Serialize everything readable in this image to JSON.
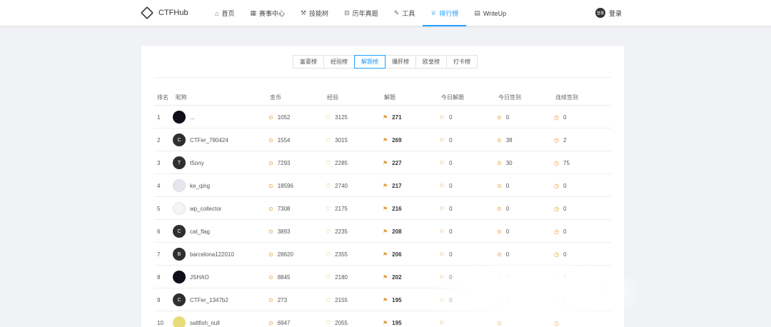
{
  "header": {
    "brand": "CTFHub",
    "nav": [
      {
        "icon": "home-icon",
        "glyph": "⌂",
        "label": "首页"
      },
      {
        "icon": "calendar-icon",
        "glyph": "▦",
        "label": "赛事中心"
      },
      {
        "icon": "skill-icon",
        "glyph": "⚒",
        "label": "技能树"
      },
      {
        "icon": "archive-icon",
        "glyph": "⊟",
        "label": "历年真题"
      },
      {
        "icon": "tool-icon",
        "glyph": "✎",
        "label": "工具"
      },
      {
        "icon": "trophy-icon",
        "glyph": "♕",
        "label": "排行榜",
        "active": true
      },
      {
        "icon": "writeup-icon",
        "glyph": "▤",
        "label": "WriteUp"
      }
    ],
    "login_avatar": "登录",
    "login_label": "登录"
  },
  "tabs": [
    "富豪榜",
    "经验榜",
    "解题榜",
    "爆肝榜",
    "欧皇榜",
    "打卡榜"
  ],
  "active_tab": "解题榜",
  "columns": [
    "排名",
    "昵称",
    "金币",
    "经验",
    "解题",
    "今日解题",
    "今日签到",
    "连续签到"
  ],
  "rows": [
    {
      "rank": "1",
      "avatar": "",
      "avatar_style": "dark",
      "name": "...",
      "coin": "1052",
      "exp": "3125",
      "solve": "271",
      "today": "0",
      "sign": "0",
      "cont": "0"
    },
    {
      "rank": "2",
      "avatar": "C",
      "avatar_style": "",
      "name": "CTFer_780424",
      "coin": "1554",
      "exp": "3015",
      "solve": "269",
      "today": "0",
      "sign": "38",
      "cont": "2"
    },
    {
      "rank": "3",
      "avatar": "T",
      "avatar_style": "",
      "name": "t5ony",
      "coin": "7293",
      "exp": "2285",
      "solve": "227",
      "today": "0",
      "sign": "30",
      "cont": "75"
    },
    {
      "rank": "4",
      "avatar": "",
      "avatar_style": "light",
      "name": "ke_qing",
      "coin": "18596",
      "exp": "2740",
      "solve": "217",
      "today": "0",
      "sign": "0",
      "cont": "0"
    },
    {
      "rank": "5",
      "avatar": "",
      "avatar_style": "pale",
      "name": "wp_collector",
      "coin": "7308",
      "exp": "2175",
      "solve": "216",
      "today": "0",
      "sign": "0",
      "cont": "0"
    },
    {
      "rank": "6",
      "avatar": "C",
      "avatar_style": "",
      "name": "cat_flag",
      "coin": "3893",
      "exp": "2235",
      "solve": "208",
      "today": "0",
      "sign": "0",
      "cont": "0"
    },
    {
      "rank": "7",
      "avatar": "B",
      "avatar_style": "",
      "name": "barcelona122010",
      "coin": "28620",
      "exp": "2355",
      "solve": "206",
      "today": "0",
      "sign": "0",
      "cont": "0"
    },
    {
      "rank": "8",
      "avatar": "",
      "avatar_style": "dark",
      "name": "JSHAO",
      "coin": "8845",
      "exp": "2180",
      "solve": "202",
      "today": "0",
      "sign": "0",
      "cont": "0"
    },
    {
      "rank": "9",
      "avatar": "C",
      "avatar_style": "",
      "name": "CTFer_1347b2",
      "coin": "273",
      "exp": "2155",
      "solve": "195",
      "today": "0",
      "sign": "0",
      "cont": "0"
    },
    {
      "rank": "10",
      "avatar": "",
      "avatar_style": "yellow",
      "name": "saltfish_null",
      "coin": "6947",
      "exp": "2055",
      "solve": "195",
      "today": "",
      "sign": "",
      "cont": ""
    }
  ]
}
